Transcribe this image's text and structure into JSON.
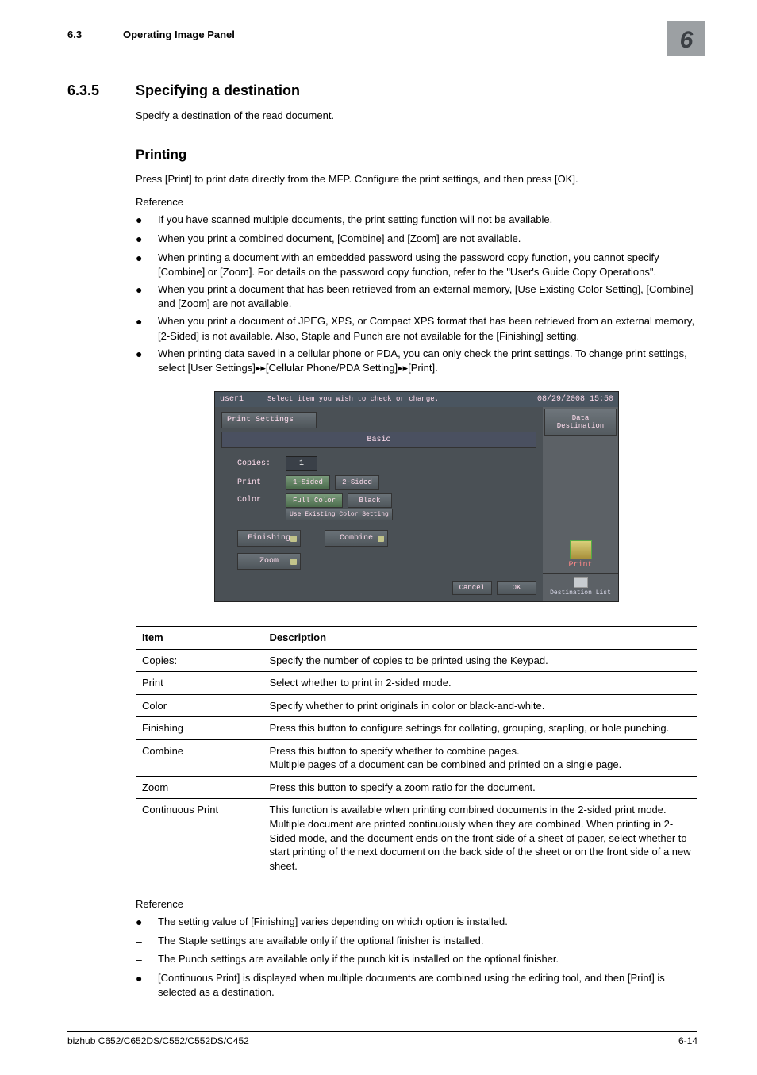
{
  "header": {
    "section_num": "6.3",
    "section_title": "Operating Image Panel",
    "chapter_badge": "6"
  },
  "section": {
    "num": "6.3.5",
    "title": "Specifying a destination",
    "intro": "Specify a destination of the read document."
  },
  "printing": {
    "heading": "Printing",
    "para": "Press [Print] to print data directly from the MFP. Configure the print settings, and then press [OK].",
    "reference_label": "Reference",
    "bullets": [
      "If you have scanned multiple documents, the print setting function will not be available.",
      "When you print a combined document, [Combine] and [Zoom] are not available.",
      "When printing a document with an embedded password using the password copy function, you cannot specify [Combine] or [Zoom]. For details on the password copy function, refer to the \"User's Guide Copy Operations\".",
      "When you print a document that has been retrieved from an external memory, [Use Existing Color Setting], [Combine] and [Zoom] are not available.",
      "When you print a document of JPEG, XPS, or Compact XPS format that has been retrieved from an external memory, [2-Sided] is not available. Also, Staple and Punch are not available for the [Finishing] setting.",
      "When printing data saved in a cellular phone or PDA, you can only check the print settings. To change print settings, select [User Settings]▸▸[Cellular Phone/PDA Setting]▸▸[Print]."
    ]
  },
  "screenshot": {
    "user": "user1",
    "message": "Select item you wish to check or change.",
    "datetime": "08/29/2008  15:50",
    "tab_print_settings": "Print Settings",
    "side_data_dest": "Data Destination",
    "basic": "Basic",
    "label_copies": "Copies:",
    "val_copies": "1",
    "label_print": "Print",
    "btn_1sided": "1-Sided",
    "btn_2sided": "2-Sided",
    "label_color": "Color",
    "btn_fullcolor": "Full Color",
    "btn_black": "Black",
    "btn_useexisting": "Use Existing Color Setting",
    "btn_finishing": "Finishing",
    "btn_combine": "Combine",
    "btn_zoom": "Zoom",
    "btn_cancel": "Cancel",
    "btn_ok": "OK",
    "side_print": "Print",
    "side_destlist": "Destination List"
  },
  "table": {
    "head_item": "Item",
    "head_desc": "Description",
    "rows": [
      {
        "item": "Copies:",
        "desc": "Specify the number of copies to be printed using the Keypad."
      },
      {
        "item": "Print",
        "desc": "Select whether to print in 2-sided mode."
      },
      {
        "item": "Color",
        "desc": "Specify whether to print originals in color or black-and-white."
      },
      {
        "item": "Finishing",
        "desc": "Press this button to configure settings for collating, grouping, stapling, or hole punching."
      },
      {
        "item": "Combine",
        "desc": "Press this button to specify whether to combine pages.\nMultiple pages of a document can be combined and printed on a single page."
      },
      {
        "item": "Zoom",
        "desc": "Press this button to specify a zoom ratio for the document."
      },
      {
        "item": "Continuous Print",
        "desc": "This function is available when printing combined documents in the 2-sided print mode.\nMultiple document are printed continuously when they are combined. When printing in 2-Sided mode, and the document ends on the front side of a sheet of paper, select whether to start printing of the next document on the back side of the sheet or on the front side of a new sheet."
      }
    ]
  },
  "reference2": {
    "label": "Reference",
    "items": [
      {
        "mark": "●",
        "text": "The setting value of [Finishing] varies depending on which option is installed."
      },
      {
        "mark": "–",
        "text": "The Staple settings are available only if the optional finisher is installed."
      },
      {
        "mark": "–",
        "text": "The Punch settings are available only if the punch kit is installed on the optional finisher."
      },
      {
        "mark": "●",
        "text": "[Continuous Print] is displayed when multiple documents are combined using the editing tool, and then [Print] is selected as a destination."
      }
    ]
  },
  "footer": {
    "model": "bizhub C652/C652DS/C552/C552DS/C452",
    "page": "6-14"
  }
}
